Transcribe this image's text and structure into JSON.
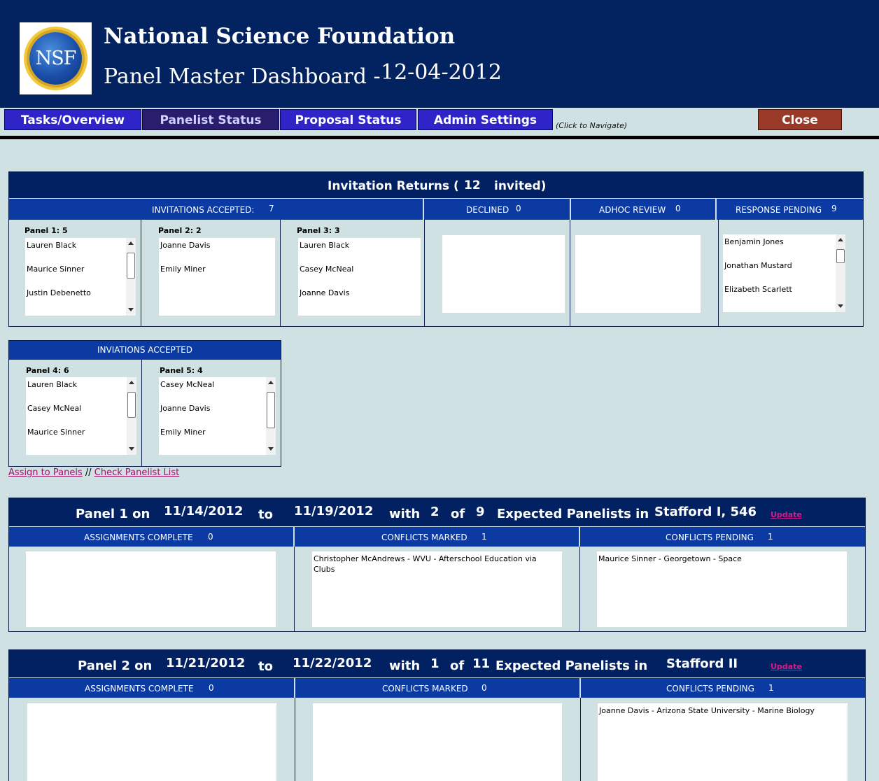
{
  "header": {
    "logo_text": "NSF",
    "org_title": "National Science Foundation",
    "dashboard_title": "Panel Master Dashboard -",
    "date": "12-04-2012"
  },
  "nav": {
    "tabs": [
      "Tasks/Overview",
      "Panelist Status",
      "Proposal Status",
      "Admin Settings"
    ],
    "active": "Panelist Status",
    "hint": "(Click to Navigate)",
    "close": "Close"
  },
  "invitations": {
    "title_prefix": "Invitation Returns (",
    "count": "12",
    "title_suffix": "invited)",
    "accepted_label": "INVITATIONS ACCEPTED:",
    "accepted_count": "7",
    "declined_label": "DECLINED",
    "declined_count": "0",
    "adhoc_label": "ADHOC REVIEW",
    "adhoc_count": "0",
    "pending_label": "RESPONSE PENDING",
    "pending_count": "9",
    "panel1": {
      "label": "Panel 1:",
      "count": "5",
      "items": [
        "Lauren Black",
        "Maurice Sinner",
        "Justin Debenetto"
      ]
    },
    "panel2": {
      "label": "Panel 2:",
      "count": "2",
      "items": [
        "Joanne Davis",
        "Emily Miner"
      ]
    },
    "panel3": {
      "label": "Panel 3:",
      "count": "3",
      "items": [
        "Lauren Black",
        "Casey McNeal",
        "Joanne Davis"
      ]
    },
    "pending_items": [
      "Benjamin Jones",
      "Jonathan Mustard",
      "Elizabeth Scarlett"
    ],
    "accepted2_label": "INVIATIONS ACCEPTED",
    "panel4": {
      "label": "Panel 4:",
      "count": "6",
      "items": [
        "Lauren Black",
        "Casey McNeal",
        "Maurice Sinner"
      ]
    },
    "panel5": {
      "label": "Panel 5:",
      "count": "4",
      "items": [
        "Casey McNeal",
        "Joanne Davis",
        "Emily Miner"
      ]
    }
  },
  "links": {
    "assign": "Assign to Panels",
    "separator": "//",
    "check": "Check Panelist List"
  },
  "panels": [
    {
      "name": "Panel 1 on",
      "start": "11/14/2012",
      "to": "to",
      "end": "11/19/2012",
      "with": "with",
      "have": "2",
      "of": "of",
      "expected": "9",
      "expected_label": "Expected Panelists in",
      "location": "Stafford I, 546",
      "update": "Update",
      "assign_label": "ASSIGNMENTS COMPLETE",
      "assign_count": "0",
      "conf_label": "CONFLICTS MARKED",
      "conf_count": "1",
      "pend_label": "CONFLICTS PENDING",
      "pend_count": "1",
      "conf_text": "Christopher McAndrews - WVU - Afterschool Education via Clubs",
      "pend_text": "Maurice Sinner - Georgetown - Space"
    },
    {
      "name": "Panel 2 on",
      "start": "11/21/2012",
      "to": "to",
      "end": "11/22/2012",
      "with": "with",
      "have": "1",
      "of": "of",
      "expected": "11",
      "expected_label": "Expected Panelists in",
      "location": "Stafford II",
      "update": "Update",
      "assign_label": "ASSIGNMENTS COMPLETE",
      "assign_count": "0",
      "conf_label": "CONFLICTS MARKED",
      "conf_count": "0",
      "pend_label": "CONFLICTS PENDING",
      "pend_count": "1",
      "conf_text": "",
      "pend_text": "Joanne Davis - Arizona State University - Marine Biology"
    }
  ]
}
